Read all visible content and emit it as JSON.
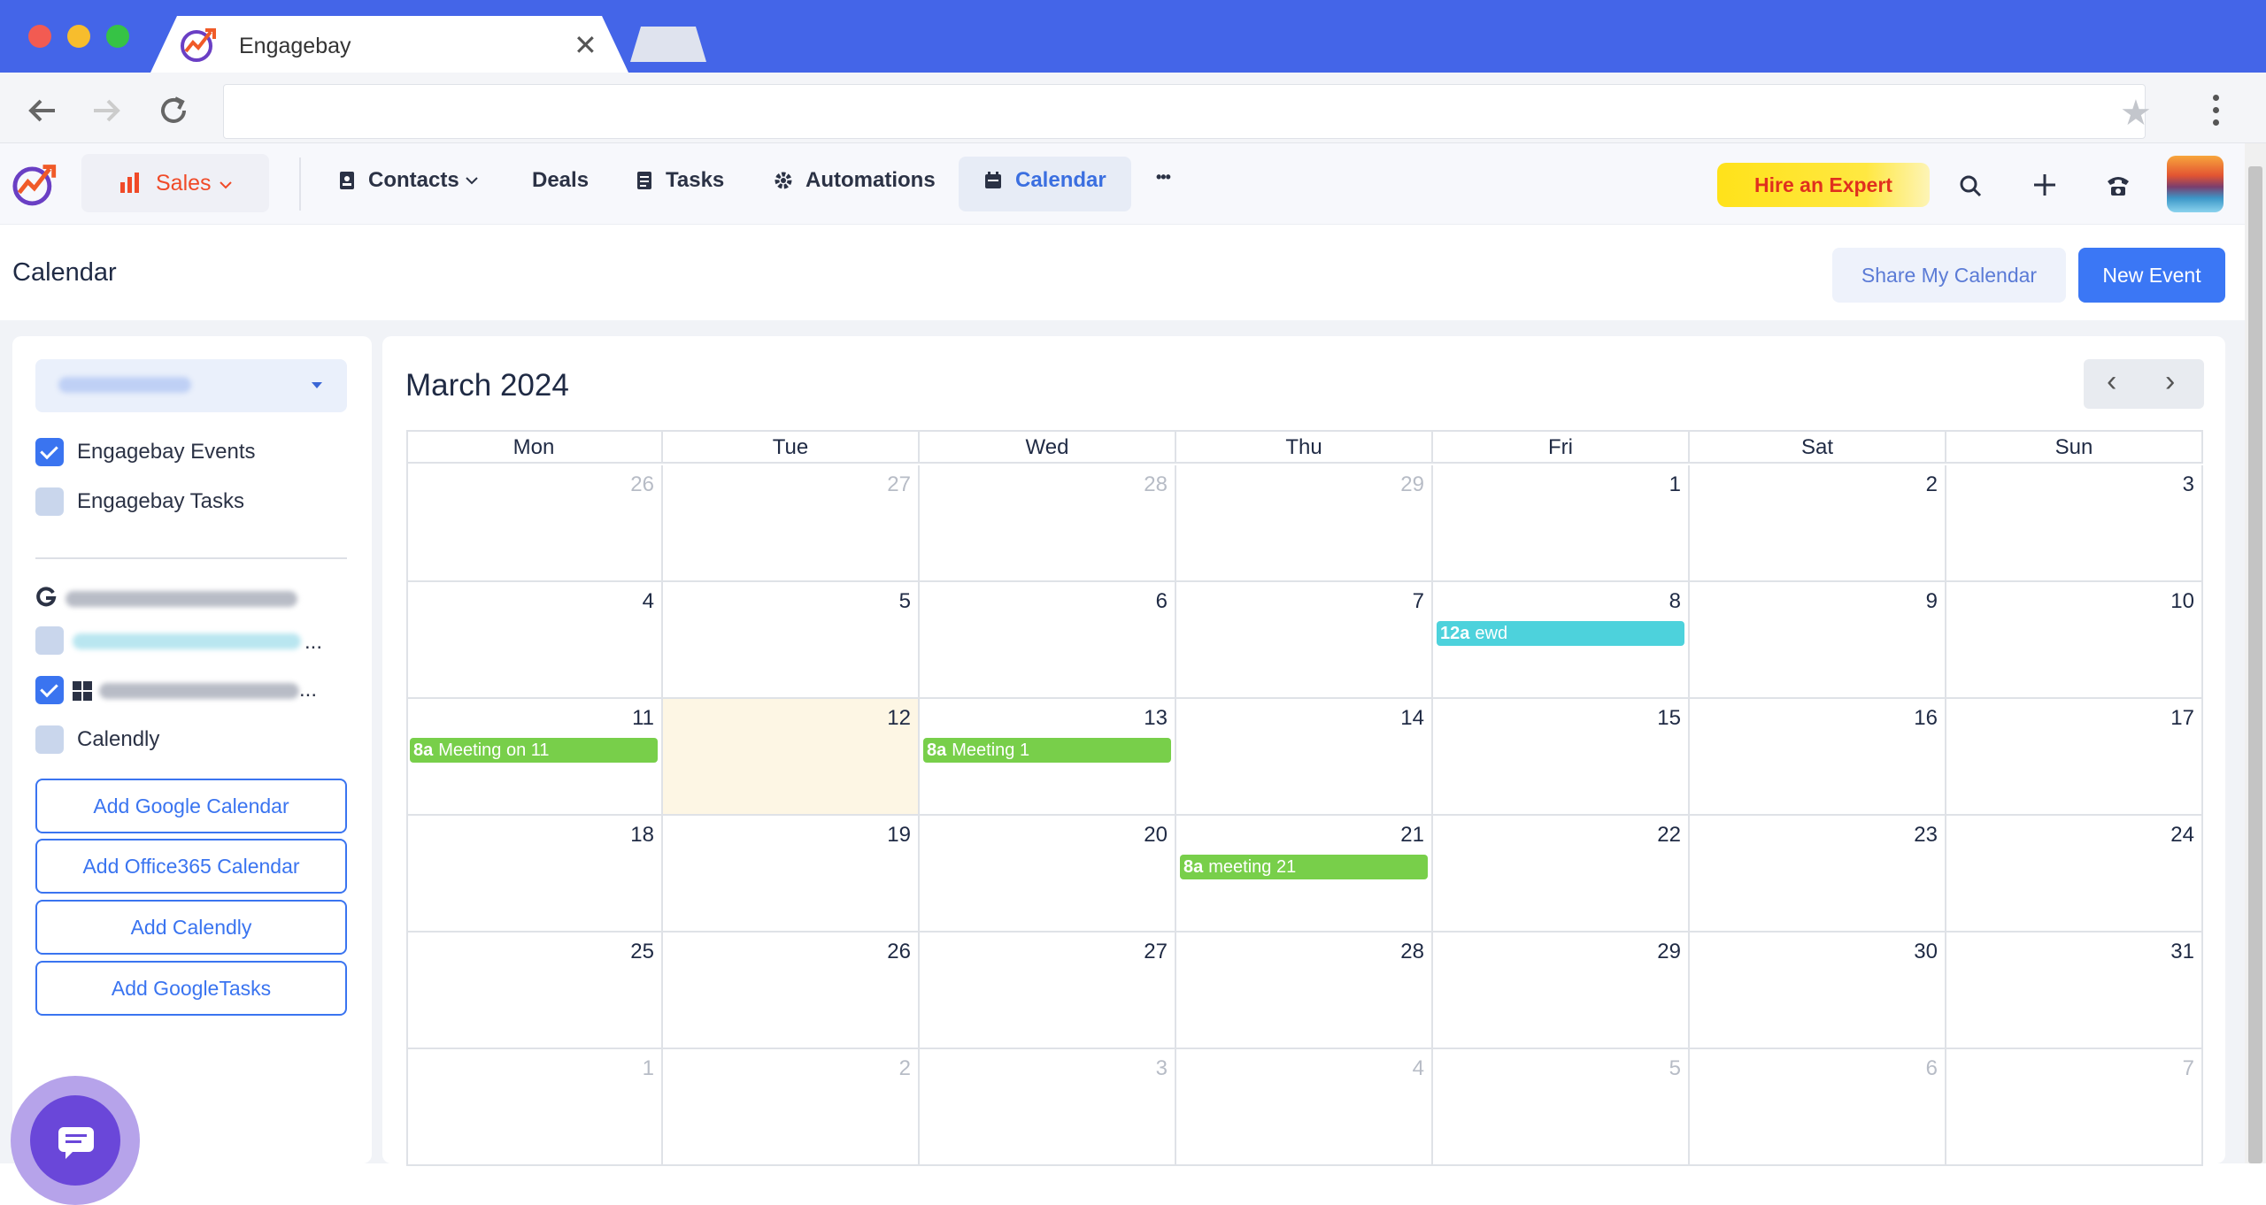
{
  "browser": {
    "tab_title": "Engagebay",
    "tab_close": "✕",
    "url": ""
  },
  "app": {
    "module": "Sales",
    "nav": [
      {
        "label": "Contacts",
        "icon": "contacts-icon"
      },
      {
        "label": "Deals"
      },
      {
        "label": "Tasks",
        "icon": "tasks-icon"
      },
      {
        "label": "Automations",
        "icon": "gear-icon"
      },
      {
        "label": "Calendar",
        "icon": "calendar-icon",
        "active": true
      }
    ],
    "more": "•••",
    "hire_expert": "Hire an Expert"
  },
  "page": {
    "title": "Calendar",
    "share_button": "Share My Calendar",
    "new_event_button": "New Event"
  },
  "sidebar": {
    "calendars": [
      {
        "label": "Engagebay Events",
        "checked": true
      },
      {
        "label": "Engagebay Tasks",
        "checked": false
      }
    ],
    "accounts_ellipsis": "...",
    "calendly": "Calendly",
    "buttons": [
      "Add Google Calendar",
      "Add Office365 Calendar",
      "Add Calendly",
      "Add GoogleTasks"
    ]
  },
  "calendar": {
    "month_label": "March 2024",
    "prev": "‹",
    "next": "›",
    "weekdays": [
      "Mon",
      "Tue",
      "Wed",
      "Thu",
      "Fri",
      "Sat",
      "Sun"
    ],
    "weeks": [
      [
        {
          "d": "26",
          "off": true
        },
        {
          "d": "27",
          "off": true
        },
        {
          "d": "28",
          "off": true
        },
        {
          "d": "29",
          "off": true
        },
        {
          "d": "1"
        },
        {
          "d": "2"
        },
        {
          "d": "3"
        }
      ],
      [
        {
          "d": "4"
        },
        {
          "d": "5"
        },
        {
          "d": "6"
        },
        {
          "d": "7"
        },
        {
          "d": "8",
          "event": {
            "time": "12a",
            "title": "ewd",
            "color": "#4dd2dc"
          }
        },
        {
          "d": "9"
        },
        {
          "d": "10"
        }
      ],
      [
        {
          "d": "11",
          "event": {
            "time": "8a",
            "title": "Meeting on 11",
            "color": "#78cf4a"
          }
        },
        {
          "d": "12",
          "today": true
        },
        {
          "d": "13",
          "event": {
            "time": "8a",
            "title": "Meeting 1",
            "color": "#78cf4a"
          }
        },
        {
          "d": "14"
        },
        {
          "d": "15"
        },
        {
          "d": "16"
        },
        {
          "d": "17"
        }
      ],
      [
        {
          "d": "18"
        },
        {
          "d": "19"
        },
        {
          "d": "20"
        },
        {
          "d": "21",
          "event": {
            "time": "8a",
            "title": "meeting 21",
            "color": "#78cf4a"
          }
        },
        {
          "d": "22"
        },
        {
          "d": "23"
        },
        {
          "d": "24"
        }
      ],
      [
        {
          "d": "25"
        },
        {
          "d": "26"
        },
        {
          "d": "27"
        },
        {
          "d": "28"
        },
        {
          "d": "29"
        },
        {
          "d": "30"
        },
        {
          "d": "31"
        }
      ],
      [
        {
          "d": "1",
          "off": true
        },
        {
          "d": "2",
          "off": true
        },
        {
          "d": "3",
          "off": true
        },
        {
          "d": "4",
          "off": true
        },
        {
          "d": "5",
          "off": true
        },
        {
          "d": "6",
          "off": true
        },
        {
          "d": "7",
          "off": true
        }
      ]
    ]
  },
  "colors": {
    "browser_blue": "#4465e8",
    "primary": "#3b77f5",
    "sales_red": "#f04a28",
    "today_bg": "#fdf6e4"
  }
}
